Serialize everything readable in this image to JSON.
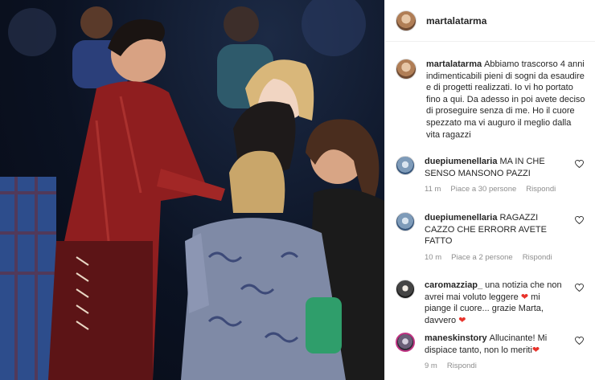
{
  "post": {
    "author": "martalatarma",
    "caption": "Abbiamo trascorso 4 anni indimenticabili pieni di sogni da esaudire e di progetti realizzati. Io vi ho portato fino a qui. Da adesso in poi avete deciso di proseguire senza di me. Ho il cuore spezzato ma vi auguro il meglio dalla vita ragazzi"
  },
  "comments": [
    {
      "user": "duepiumenellaria",
      "text": "MA IN CHE SENSO MANSONO PAZZI",
      "time": "11 m",
      "likes": "Piace a 30 persone",
      "reply": "Rispondi"
    },
    {
      "user": "duepiumenellaria",
      "text": "RAGAZZI CAZZO CHE ERRORR AVETE FATTO",
      "time": "10 m",
      "likes": "Piace a 2 persone",
      "reply": "Rispondi"
    },
    {
      "user": "caromazziap_",
      "text_a": "una notizia che non avrei mai voluto leggere",
      "text_b": "mi piange il cuore... grazie Marta, davvero",
      "time": "",
      "likes": "",
      "reply": ""
    },
    {
      "user": "maneskinstory",
      "text": "Allucinante! Mi dispiace tanto, non lo meriti",
      "time": "9 m",
      "reply": "Rispondi"
    }
  ],
  "icons": {
    "heart_outline": "heart-outline-icon",
    "heart_red": "red-heart-emoji"
  },
  "colors": {
    "text": "#262626",
    "muted": "#8e8e8e",
    "border": "#efefef",
    "emoji_red": "#e8332b"
  }
}
